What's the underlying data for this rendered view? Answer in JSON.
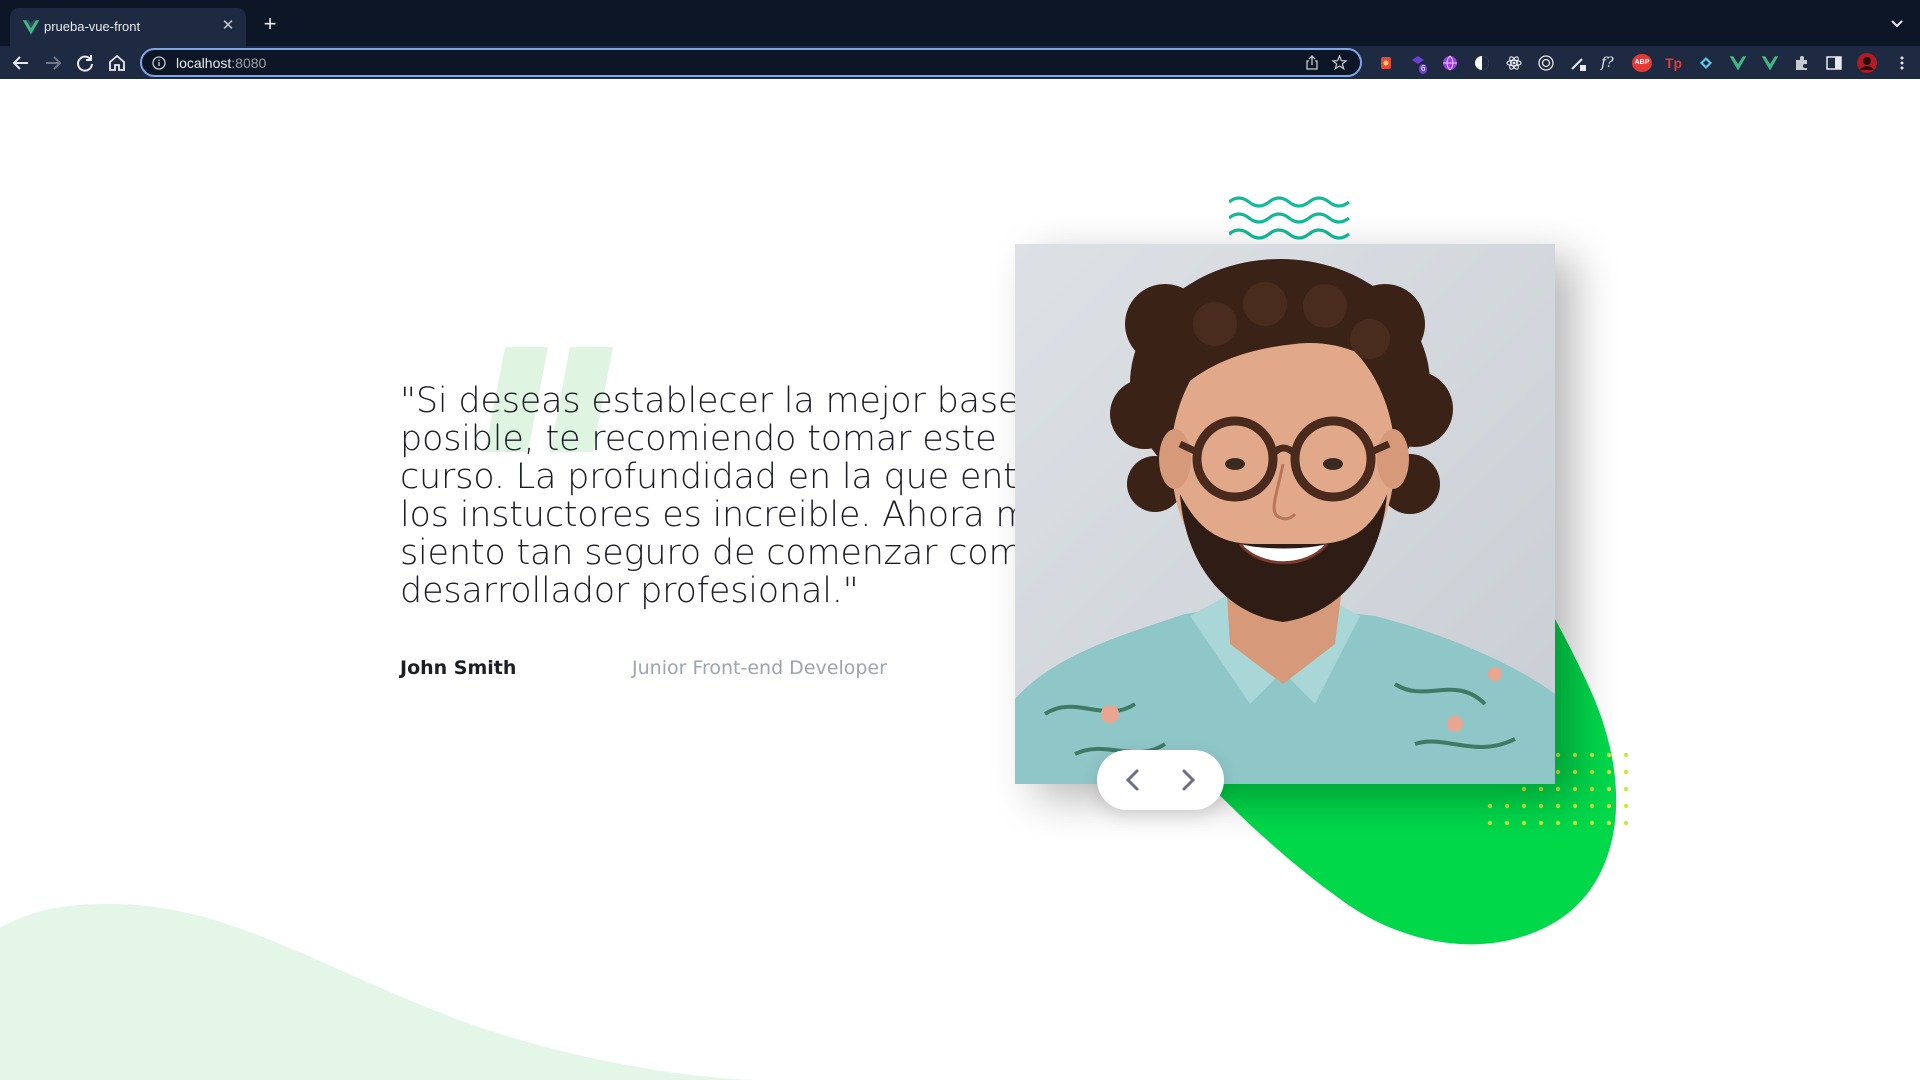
{
  "browser": {
    "tab_title": "prueba-vue-front",
    "url_host": "localhost",
    "url_port": ":8080",
    "accent": "#7ea6e6",
    "extensions": [
      "recorder-icon",
      "bookmark-ext-icon",
      "globe-ext-icon",
      "circle-ext-icon",
      "react-icon",
      "target-icon",
      "pen-icon",
      "function-icon",
      "abp-icon",
      "tp-icon",
      "grid-ext-icon",
      "vue-icon",
      "vue-devtools-icon",
      "puzzle-icon",
      "sidepanel-icon",
      "profile-avatar-icon"
    ],
    "extension_labels": {
      "abp": "ABP",
      "tp": "Tp",
      "function": "f?",
      "badge": "6"
    }
  },
  "testimonial": {
    "quote": "\"Si deseas establecer la mejor base posible, te recomiendo tomar este curso. La profundidad en la que entran los instuctores es increible. Ahora me siento tan seguro de comenzar como desarrollador profesional.\"",
    "author_name": "John Smith",
    "author_role": "Junior Front-end Developer"
  },
  "colors": {
    "blob_green": "#00d84a",
    "wave_teal": "#14b89a",
    "dots_yellow": "#c8ea3c",
    "bg_wave": "#e4f6e7",
    "quote_mark": "#dff5e2"
  },
  "carousel": {
    "prev_icon": "chevron-left-icon",
    "next_icon": "chevron-right-icon"
  }
}
